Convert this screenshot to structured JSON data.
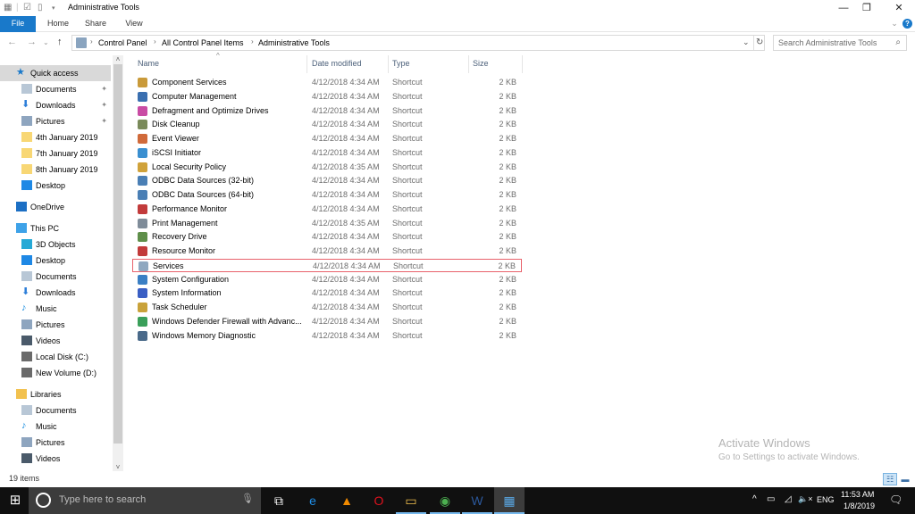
{
  "window": {
    "title": "Administrative Tools",
    "controls": {
      "minimize": "—",
      "restore": "❐",
      "close": "✕"
    }
  },
  "ribbon": {
    "tabs": [
      "File",
      "Home",
      "Share",
      "View"
    ],
    "expand_icon": "⌄",
    "help_icon": "?"
  },
  "nav": {
    "back": "←",
    "forward": "→",
    "recent": "⌄",
    "up": "↑",
    "breadcrumb": [
      "Control Panel",
      "All Control Panel Items",
      "Administrative Tools"
    ],
    "refresh": "↻",
    "dropdown": "⌄",
    "search_placeholder": "Search Administrative Tools",
    "search_icon": "⌕"
  },
  "sidebar": {
    "items": [
      {
        "label": "Quick access",
        "icon": "star-icon",
        "color": "#1979ca",
        "indent": 0,
        "selected": true
      },
      {
        "label": "Documents",
        "icon": "documents-icon",
        "color": "#b8c7d6",
        "indent": 1,
        "pinned": true
      },
      {
        "label": "Downloads",
        "icon": "downloads-icon",
        "color": "#2e7fd9",
        "indent": 1,
        "pinned": true
      },
      {
        "label": "Pictures",
        "icon": "pictures-icon",
        "color": "#8ea5bf",
        "indent": 1,
        "pinned": true
      },
      {
        "label": "4th January 2019",
        "icon": "folder-icon",
        "color": "#f8d775",
        "indent": 1
      },
      {
        "label": "7th January 2019",
        "icon": "folder-icon",
        "color": "#f8d775",
        "indent": 1
      },
      {
        "label": "8th January 2019",
        "icon": "folder-icon",
        "color": "#f8d775",
        "indent": 1
      },
      {
        "label": "Desktop",
        "icon": "desktop-icon",
        "color": "#1e88e5",
        "indent": 1
      },
      {
        "label": "OneDrive",
        "icon": "onedrive-icon",
        "color": "#1c6fc4",
        "indent": 0,
        "gap": true
      },
      {
        "label": "This PC",
        "icon": "computer-icon",
        "color": "#3ea2e8",
        "indent": 0,
        "gap": true
      },
      {
        "label": "3D Objects",
        "icon": "3d-objects-icon",
        "color": "#26a9d6",
        "indent": 1
      },
      {
        "label": "Desktop",
        "icon": "desktop-icon",
        "color": "#1e88e5",
        "indent": 1
      },
      {
        "label": "Documents",
        "icon": "documents-icon",
        "color": "#b8c7d6",
        "indent": 1
      },
      {
        "label": "Downloads",
        "icon": "downloads-icon",
        "color": "#2e7fd9",
        "indent": 1
      },
      {
        "label": "Music",
        "icon": "music-icon",
        "color": "#1a8fe0",
        "indent": 1
      },
      {
        "label": "Pictures",
        "icon": "pictures-icon",
        "color": "#8ea5bf",
        "indent": 1
      },
      {
        "label": "Videos",
        "icon": "videos-icon",
        "color": "#4a5a6a",
        "indent": 1
      },
      {
        "label": "Local Disk (C:)",
        "icon": "drive-icon",
        "color": "#6a6a6a",
        "indent": 1
      },
      {
        "label": "New Volume (D:)",
        "icon": "drive-icon",
        "color": "#6a6a6a",
        "indent": 1
      },
      {
        "label": "Libraries",
        "icon": "libraries-icon",
        "color": "#f2c14e",
        "indent": 0,
        "gap": true
      },
      {
        "label": "Documents",
        "icon": "documents-icon",
        "color": "#b8c7d6",
        "indent": 1
      },
      {
        "label": "Music",
        "icon": "music-icon",
        "color": "#1a8fe0",
        "indent": 1
      },
      {
        "label": "Pictures",
        "icon": "pictures-icon",
        "color": "#8ea5bf",
        "indent": 1
      },
      {
        "label": "Videos",
        "icon": "videos-icon",
        "color": "#4a5a6a",
        "indent": 1
      }
    ],
    "pin_glyph": "📌"
  },
  "filelist": {
    "columns": [
      "Name",
      "Date modified",
      "Type",
      "Size"
    ],
    "sort_glyph": "^",
    "rows": [
      {
        "name": "Component Services",
        "date": "4/12/2018 4:34 AM",
        "type": "Shortcut",
        "size": "2 KB",
        "icon": "component-services-icon",
        "color": "#c99a3a"
      },
      {
        "name": "Computer Management",
        "date": "4/12/2018 4:34 AM",
        "type": "Shortcut",
        "size": "2 KB",
        "icon": "computer-management-icon",
        "color": "#3a6fb0"
      },
      {
        "name": "Defragment and Optimize Drives",
        "date": "4/12/2018 4:34 AM",
        "type": "Shortcut",
        "size": "2 KB",
        "icon": "defragment-icon",
        "color": "#c94ca4"
      },
      {
        "name": "Disk Cleanup",
        "date": "4/12/2018 4:34 AM",
        "type": "Shortcut",
        "size": "2 KB",
        "icon": "disk-cleanup-icon",
        "color": "#7a8a5a"
      },
      {
        "name": "Event Viewer",
        "date": "4/12/2018 4:34 AM",
        "type": "Shortcut",
        "size": "2 KB",
        "icon": "event-viewer-icon",
        "color": "#d06a3a"
      },
      {
        "name": "iSCSI Initiator",
        "date": "4/12/2018 4:34 AM",
        "type": "Shortcut",
        "size": "2 KB",
        "icon": "iscsi-icon",
        "color": "#3a8fd0"
      },
      {
        "name": "Local Security Policy",
        "date": "4/12/2018 4:35 AM",
        "type": "Shortcut",
        "size": "2 KB",
        "icon": "security-policy-icon",
        "color": "#d0a23a"
      },
      {
        "name": "ODBC Data Sources (32-bit)",
        "date": "4/12/2018 4:34 AM",
        "type": "Shortcut",
        "size": "2 KB",
        "icon": "odbc-icon",
        "color": "#4a7fb5"
      },
      {
        "name": "ODBC Data Sources (64-bit)",
        "date": "4/12/2018 4:34 AM",
        "type": "Shortcut",
        "size": "2 KB",
        "icon": "odbc-icon",
        "color": "#4a7fb5"
      },
      {
        "name": "Performance Monitor",
        "date": "4/12/2018 4:34 AM",
        "type": "Shortcut",
        "size": "2 KB",
        "icon": "performance-monitor-icon",
        "color": "#c23b3b"
      },
      {
        "name": "Print Management",
        "date": "4/12/2018 4:35 AM",
        "type": "Shortcut",
        "size": "2 KB",
        "icon": "print-management-icon",
        "color": "#7f8c99"
      },
      {
        "name": "Recovery Drive",
        "date": "4/12/2018 4:34 AM",
        "type": "Shortcut",
        "size": "2 KB",
        "icon": "recovery-drive-icon",
        "color": "#5f8f4a"
      },
      {
        "name": "Resource Monitor",
        "date": "4/12/2018 4:34 AM",
        "type": "Shortcut",
        "size": "2 KB",
        "icon": "resource-monitor-icon",
        "color": "#c23b3b"
      },
      {
        "name": "Services",
        "date": "4/12/2018 4:34 AM",
        "type": "Shortcut",
        "size": "2 KB",
        "icon": "services-icon",
        "color": "#8fa8c0",
        "highlighted": true
      },
      {
        "name": "System Configuration",
        "date": "4/12/2018 4:34 AM",
        "type": "Shortcut",
        "size": "2 KB",
        "icon": "system-configuration-icon",
        "color": "#3a7fc4"
      },
      {
        "name": "System Information",
        "date": "4/12/2018 4:34 AM",
        "type": "Shortcut",
        "size": "2 KB",
        "icon": "system-information-icon",
        "color": "#3a5fc4"
      },
      {
        "name": "Task Scheduler",
        "date": "4/12/2018 4:34 AM",
        "type": "Shortcut",
        "size": "2 KB",
        "icon": "task-scheduler-icon",
        "color": "#c9a23a"
      },
      {
        "name": "Windows Defender Firewall with Advanc...",
        "date": "4/12/2018 4:34 AM",
        "type": "Shortcut",
        "size": "2 KB",
        "icon": "firewall-icon",
        "color": "#3a9f5a"
      },
      {
        "name": "Windows Memory Diagnostic",
        "date": "4/12/2018 4:34 AM",
        "type": "Shortcut",
        "size": "2 KB",
        "icon": "memory-diagnostic-icon",
        "color": "#4a6a8a"
      }
    ]
  },
  "status": {
    "item_count": "19 items",
    "view_details": "☷",
    "view_large": "▬"
  },
  "watermark": {
    "title": "Activate Windows",
    "subtitle": "Go to Settings to activate Windows."
  },
  "taskbar": {
    "start_icon": "⊞",
    "search_placeholder": "Type here to search",
    "mic_icon": "🎙",
    "apps": [
      {
        "name": "task-view",
        "glyph": "⧉",
        "color": "#ffffff"
      },
      {
        "name": "edge",
        "glyph": "e",
        "color": "#1f8ee8"
      },
      {
        "name": "vlc",
        "glyph": "▲",
        "color": "#f08a00"
      },
      {
        "name": "opera",
        "glyph": "O",
        "color": "#e0121e"
      },
      {
        "name": "file-explorer",
        "glyph": "▭",
        "color": "#f2c14e"
      },
      {
        "name": "chrome",
        "glyph": "◉",
        "color": "#4caf50"
      },
      {
        "name": "word",
        "glyph": "W",
        "color": "#2b579a"
      },
      {
        "name": "control-panel",
        "glyph": "▦",
        "color": "#5aa9e6"
      }
    ],
    "tray": {
      "chevron": "^",
      "battery": "▭",
      "wifi": "◿",
      "volume": "🔈×",
      "language": "ENG",
      "time": "11:53 AM",
      "date": "1/8/2019",
      "notifications": "🗨"
    }
  },
  "colors": {
    "accent": "#1979ca",
    "highlight_border": "#e8626b",
    "taskbar": "#101010"
  }
}
